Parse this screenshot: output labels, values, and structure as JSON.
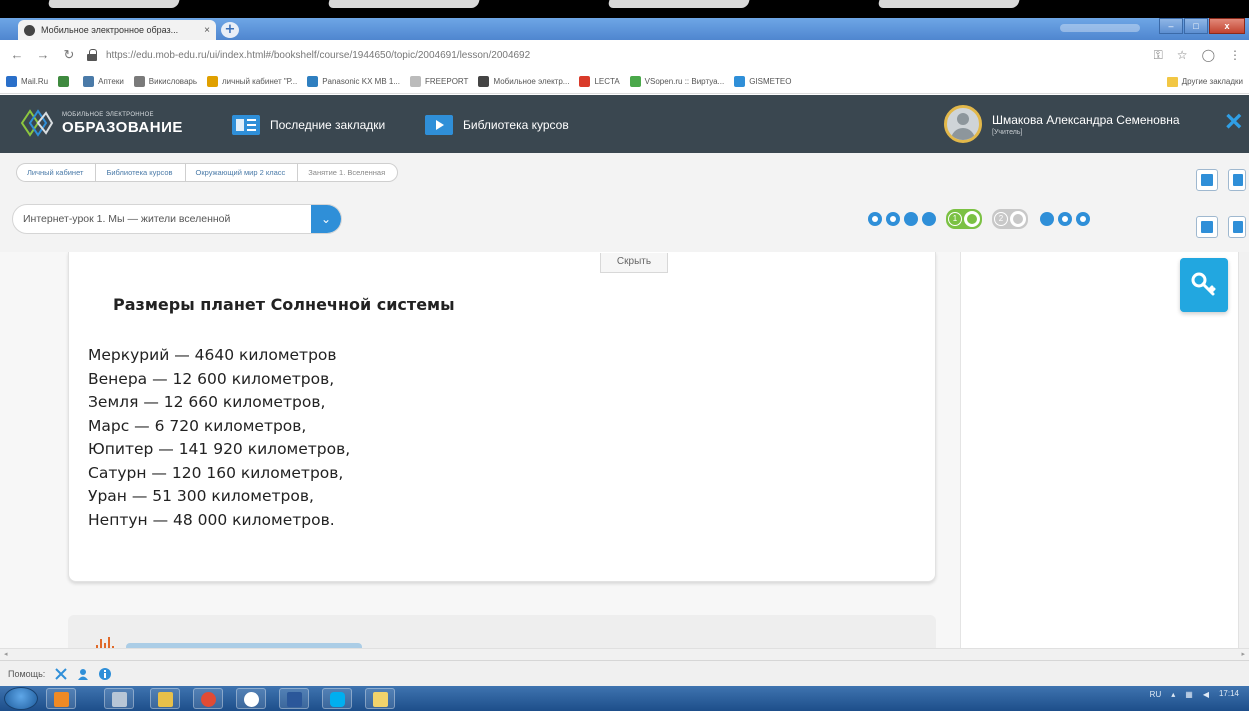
{
  "browser": {
    "tab_title": "Мобильное электронное образ...",
    "tab_close": "×",
    "new_tab": "+",
    "window_controls": [
      "–",
      "□",
      "x"
    ],
    "url": "https://edu.mob-edu.ru/ui/index.html#/bookshelf/course/1944650/topic/2004691/lesson/2004692",
    "bookmarks": [
      {
        "label": "Mail.Ru",
        "color": "#2a6fc9"
      },
      {
        "label": "",
        "color": "#3f8a3f"
      },
      {
        "label": "Аптеки",
        "color": "#4a7aa8"
      },
      {
        "label": "Викисловарь",
        "color": "#7a7a7a"
      },
      {
        "label": "личный кабинет \"Р...",
        "color": "#e0a000"
      },
      {
        "label": "Panasonic KX MB 1...",
        "color": "#2f7fc0"
      },
      {
        "label": "FREEPORT",
        "color": "#bbbbbb"
      },
      {
        "label": "Мобильное электр...",
        "color": "#444444"
      },
      {
        "label": "LECTA",
        "color": "#d93a2a"
      },
      {
        "label": "VSopen.ru :: Виртуа...",
        "color": "#4aa84a"
      },
      {
        "label": "GISMETEO",
        "color": "#2f8fd8"
      }
    ],
    "other_bookmarks": "Другие закладки"
  },
  "header": {
    "logo_small": "МОБИЛЬНОЕ ЭЛЕКТРОННОЕ",
    "logo_big": "ОБРАЗОВАНИЕ",
    "nav": [
      {
        "label": "Последние закладки"
      },
      {
        "label": "Библиотека курсов"
      }
    ],
    "user_name": "Шмакова Александра Семеновна",
    "user_role": "[Учитель]",
    "close": "×"
  },
  "breadcrumbs": [
    {
      "label": "Личный кабинет"
    },
    {
      "label": "Библиотека курсов"
    },
    {
      "label": "Окружающий мир 2 класс"
    },
    {
      "label": "Занятие 1. Вселенная"
    }
  ],
  "lesson": {
    "selected": "Интернет-урок 1. Мы — жители вселенной",
    "pager_steps": [
      "1",
      "2"
    ]
  },
  "card": {
    "hide_label": "Скрыть",
    "title": "Размеры планет Солнечной системы",
    "planets": [
      "Меркурий — 4640 километров",
      "Венера — 12 600 километров,",
      "Земля — 12 660 километров,",
      "Марс — 6 720 километров,",
      "Юпитер — 141 920 километров,",
      "Сатурн — 120 160 километров,",
      "Уран — 51 300 километров,",
      "Нептун — 48 000 километров."
    ]
  },
  "helpbar": {
    "label": "Помощь:"
  },
  "taskbar": {
    "lang": "RU",
    "time": "17:14"
  },
  "colors": {
    "accent": "#2f8fd8",
    "header_bg": "#3a4750",
    "pill_green": "#7bc143"
  }
}
